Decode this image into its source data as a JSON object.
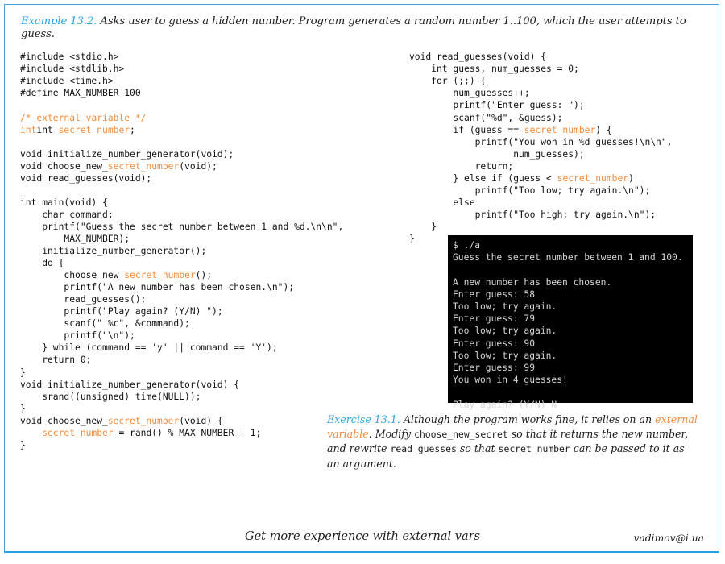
{
  "theme": {
    "frame_color": "#3e9fdc",
    "frame_bottom_color": "#23a0e0",
    "accent_blue": "#2ba3e3",
    "accent_orange": "#f08c3c",
    "terminal_bg": "#000000",
    "terminal_fg": "#d6d6d6",
    "text_color": "#1a1a1a"
  },
  "caption": {
    "label": "Example 13.2.",
    "text": " Asks user to guess a hidden number. Program generates a random number 1..100, which the user attempts to guess."
  },
  "code_left": {
    "language": "c",
    "lines": [
      "#include <stdio.h>",
      "#include <stdlib.h>",
      "#include <time.h>",
      "#define MAX_NUMBER 100",
      "",
      "/* external variable */",
      "int secret_number;",
      "",
      "void initialize_number_generator(void);",
      "void choose_new_secret_number(void);",
      "void read_guesses(void);",
      "",
      "int main(void) {",
      "    char command;",
      "    printf(\"Guess the secret number between 1 and %d.\\n\\n\",",
      "        MAX_NUMBER);",
      "    initialize_number_generator();",
      "    do {",
      "        choose_new_secret_number();",
      "        printf(\"A new number has been chosen.\\n\");",
      "        read_guesses();",
      "        printf(\"Play again? (Y/N) \");",
      "        scanf(\" %c\", &command);",
      "        printf(\"\\n\");",
      "    } while (command == 'y' || command == 'Y');",
      "    return 0;",
      "}",
      "void initialize_number_generator(void) {",
      "    srand((unsigned) time(NULL));",
      "}",
      "void choose_new_secret_number(void) {",
      "    secret_number = rand() % MAX_NUMBER + 1;",
      "}"
    ],
    "highlighted_identifiers": [
      "/* external variable */",
      "int secret_number;",
      "secret_number"
    ]
  },
  "code_right": {
    "language": "c",
    "lines": [
      "void read_guesses(void) {",
      "    int guess, num_guesses = 0;",
      "    for (;;) {",
      "        num_guesses++;",
      "        printf(\"Enter guess: \");",
      "        scanf(\"%d\", &guess);",
      "        if (guess == secret_number) {",
      "            printf(\"You won in %d guesses!\\n\\n\",",
      "                   num_guesses);",
      "            return;",
      "        } else if (guess < secret_number)",
      "            printf(\"Too low; try again.\\n\");",
      "        else",
      "            printf(\"Too high; try again.\\n\");",
      "    }",
      "}"
    ],
    "highlighted_identifiers": [
      "secret_number"
    ]
  },
  "terminal": {
    "lines": [
      "$ ./a",
      "Guess the secret number between 1 and 100.",
      "",
      "A new number has been chosen.",
      "Enter guess: 58",
      "Too low; try again.",
      "Enter guess: 79",
      "Too low; try again.",
      "Enter guess: 90",
      "Too low; try again.",
      "Enter guess: 99",
      "You won in 4 guesses!",
      "",
      "Play again? (Y/N) N"
    ]
  },
  "exercise": {
    "label": "Exercise 13.1.",
    "part1": "  Although the program works fine, it relies on an ",
    "highlight": "external variable",
    "part2": ".  Modify ",
    "code1": "choose_new_secret",
    "part3": " so that it returns the new number, and rewrite ",
    "code2": "read_guesses",
    "part4": " so that ",
    "code3": "secret_number",
    "part5": " can be passed to it as an argument."
  },
  "footer": {
    "title": "Get more experience with external vars",
    "email": "vadimov@i.ua"
  }
}
